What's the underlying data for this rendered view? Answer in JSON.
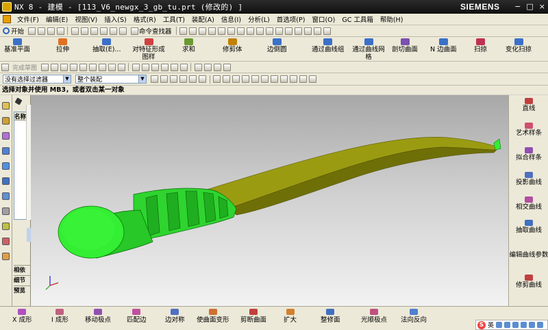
{
  "window": {
    "title": "NX 8 - 建模 - [113_V6_newgx_3_gb_tu.prt  (修改的) ]",
    "brand": "SIEMENS",
    "controls": [
      "−",
      "□",
      "×"
    ]
  },
  "menubar": {
    "items": [
      "文件(F)",
      "编辑(E)",
      "视图(V)",
      "插入(S)",
      "格式(R)",
      "工具(T)",
      "装配(A)",
      "信息(I)",
      "分析(L)",
      "首选项(P)",
      "窗口(O)",
      "GC 工具箱",
      "帮助(H)"
    ]
  },
  "toolbar_std": {
    "start_label": "开始",
    "command_finder_label": "命令查找器"
  },
  "feature_toolbar": {
    "items": [
      {
        "label": "基准平面",
        "color": "#3a70c8"
      },
      {
        "label": "拉伸",
        "color": "#e07020"
      },
      {
        "label": "抽取(E)...",
        "color": "#3a70c8"
      },
      {
        "label": "对特征形成图样",
        "color": "#d04040"
      },
      {
        "label": "求和",
        "color": "#6a9a30"
      },
      {
        "label": "修剪体",
        "color": "#c08000"
      },
      {
        "label": "边倒圆",
        "color": "#3a70c8"
      },
      {
        "label": "通过曲线组",
        "color": "#3a70c8"
      },
      {
        "label": "通过曲线网格",
        "color": "#3a70c8"
      },
      {
        "label": "剖切曲面",
        "color": "#7a50b0"
      },
      {
        "label": "N 边曲面",
        "color": "#3a70c8"
      },
      {
        "label": "扫掠",
        "color": "#c03050"
      },
      {
        "label": "变化扫掠",
        "color": "#3a70c8"
      }
    ]
  },
  "sketch_toolbar": {
    "sketch_label": "完成草图"
  },
  "selection_bar": {
    "filter_value": "没有选择过滤器",
    "scope_value": "整个装配"
  },
  "cue_line": "选择对象并使用 MB3，或者双击某一对象",
  "navigator": {
    "column_header": "名称",
    "section_dependents": "相依",
    "section_details": "细节",
    "section_preview": "预览"
  },
  "right_toolbar": {
    "items": [
      "直线",
      "艺术样条",
      "拟合样条",
      "投影曲线",
      "相交曲线",
      "抽取曲线",
      "编辑曲线参数",
      "修剪曲线"
    ]
  },
  "bottom_toolbar": {
    "items": [
      "X 成形",
      "I 成形",
      "移动极点",
      "匹配边",
      "边对称",
      "使曲面变形",
      "剪断曲面",
      "扩大",
      "整修面",
      "光顺极点",
      "法向反向"
    ]
  },
  "ime": {
    "mode": "英"
  },
  "colors": {
    "model_green": "#33ee33",
    "model_olive": "#9a9a10",
    "viewport_top": "#a8a8a8",
    "viewport_bottom": "#f2f2f2"
  }
}
